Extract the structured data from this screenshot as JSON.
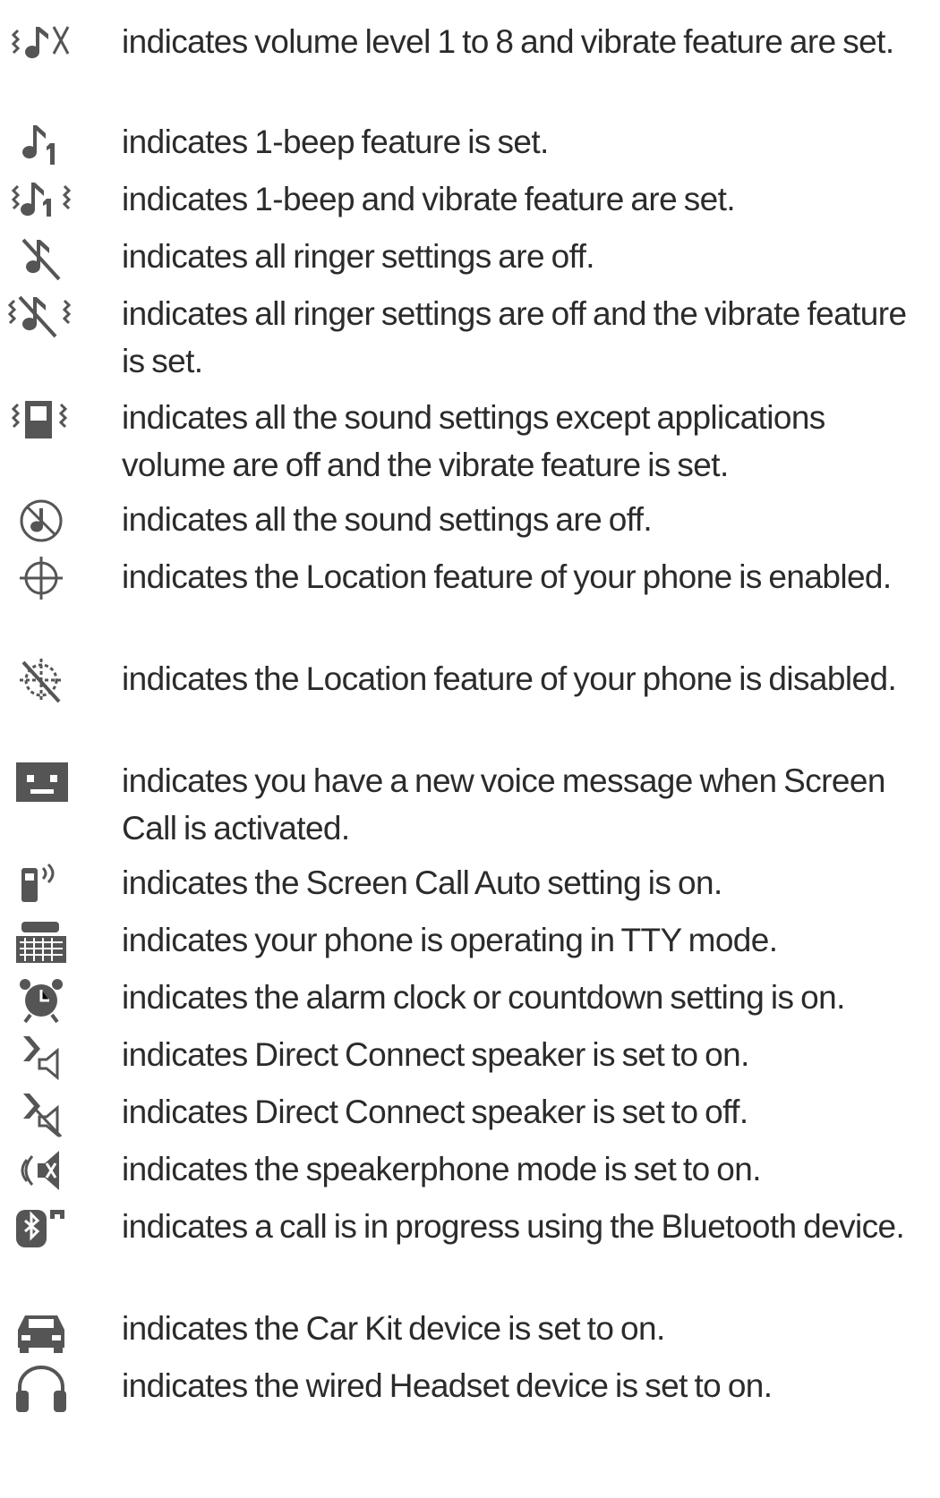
{
  "icon_list": [
    {
      "icon": "vibrate-volume-icon",
      "text": "indicates volume level 1 to 8 and vibrate feature are set."
    },
    {
      "icon": "one-beep-icon",
      "text": "indicates 1-beep feature is set."
    },
    {
      "icon": "one-beep-vibrate-icon",
      "text": "indicates 1-beep and vibrate feature are set."
    },
    {
      "icon": "ringer-off-icon",
      "text": "indicates all ringer settings are off."
    },
    {
      "icon": "ringer-off-vibrate-icon",
      "text": "indicates all ringer settings are off and the vibrate feature is set."
    },
    {
      "icon": "vibrate-only-icon",
      "text": "indicates all the sound settings except applications volume are off and the vibrate feature is set."
    },
    {
      "icon": "all-sound-off-icon",
      "text": "indicates all the sound settings are off."
    },
    {
      "icon": "location-on-icon",
      "text": "indicates the Location feature of your phone is enabled."
    },
    {
      "icon": "location-off-icon",
      "text": "indicates the Location feature of your phone is disabled."
    },
    {
      "icon": "voice-message-icon",
      "text": "indicates you have a new voice message when Screen Call is activated."
    },
    {
      "icon": "screen-call-auto-icon",
      "text": "indicates the Screen Call Auto setting is on."
    },
    {
      "icon": "tty-icon",
      "text": "indicates your phone is operating in TTY mode."
    },
    {
      "icon": "alarm-clock-icon",
      "text": "indicates the alarm clock or countdown setting is on."
    },
    {
      "icon": "dc-speaker-on-icon",
      "text": "indicates Direct Connect speaker is set to on."
    },
    {
      "icon": "dc-speaker-off-icon",
      "text": "indicates Direct Connect speaker is set to off."
    },
    {
      "icon": "speakerphone-icon",
      "text": "indicates the speakerphone mode is set to on."
    },
    {
      "icon": "bluetooth-call-icon",
      "text": "indicates a call is in progress using the Bluetooth device."
    },
    {
      "icon": "car-kit-icon",
      "text": "indicates the Car Kit device is set to on."
    },
    {
      "icon": "headset-icon",
      "text": "indicates the wired Headset device is set to on."
    }
  ]
}
